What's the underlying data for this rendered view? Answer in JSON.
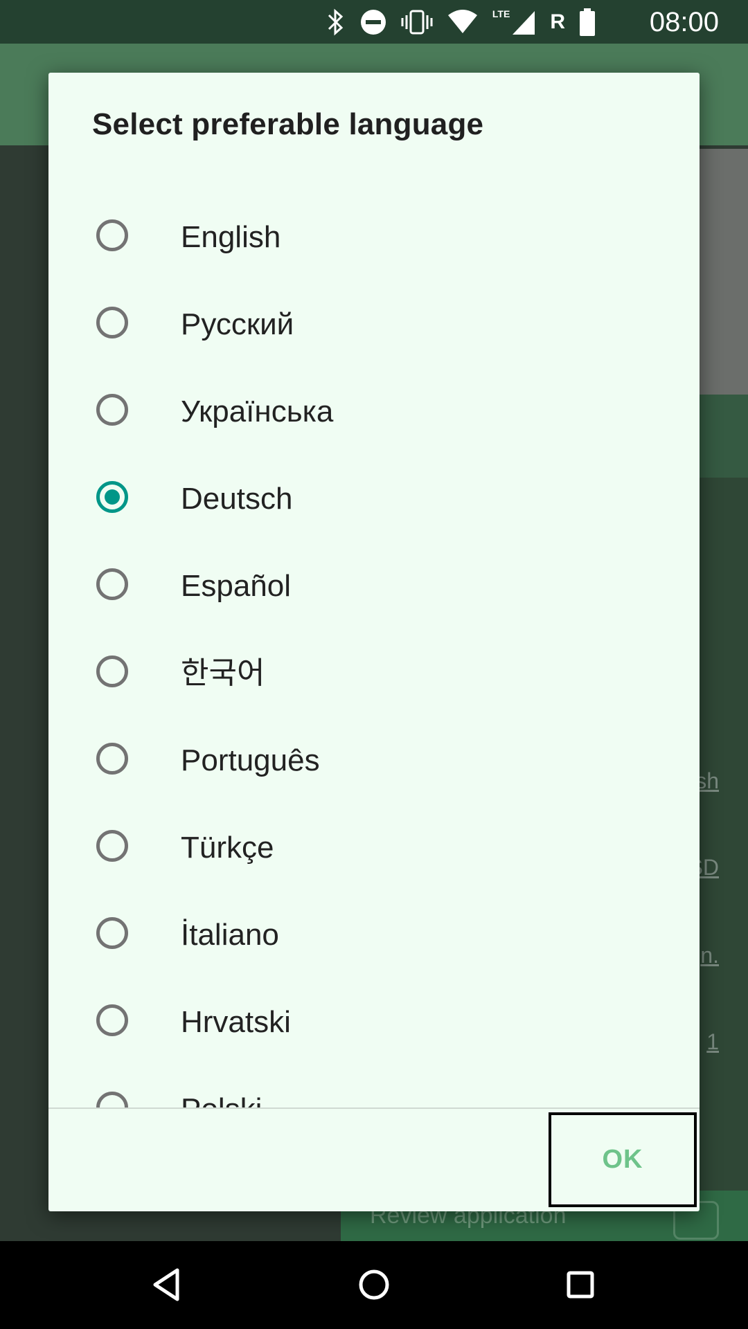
{
  "status_bar": {
    "time": "08:00",
    "roaming_indicator": "R",
    "network_type": "LTE",
    "icons": [
      "bluetooth-icon",
      "do-not-disturb-icon",
      "vibrate-icon",
      "wifi-icon",
      "cell-signal-icon",
      "battery-icon"
    ]
  },
  "background": {
    "links": [
      "sh",
      "SD",
      "n.",
      "1"
    ],
    "review_label": "Review application"
  },
  "dialog": {
    "title": "Select preferable language",
    "options": [
      {
        "label": "English",
        "checked": false
      },
      {
        "label": "Русский",
        "checked": false
      },
      {
        "label": "Українська",
        "checked": false
      },
      {
        "label": "Deutsch",
        "checked": true
      },
      {
        "label": "Español",
        "checked": false
      },
      {
        "label": "한국어",
        "checked": false
      },
      {
        "label": "Português",
        "checked": false
      },
      {
        "label": "Türkçe",
        "checked": false
      },
      {
        "label": "İtaliano",
        "checked": false
      },
      {
        "label": "Hrvatski",
        "checked": false
      },
      {
        "label": "Polski",
        "checked": false
      }
    ],
    "ok_label": "OK"
  },
  "colors": {
    "accent": "#009688",
    "ok_text": "#6ec38a",
    "dialog_bg": "#f0fdf3",
    "status_bar": "#244130"
  },
  "nav_bar": {
    "icons": [
      "back-icon",
      "home-icon",
      "recents-icon"
    ]
  }
}
